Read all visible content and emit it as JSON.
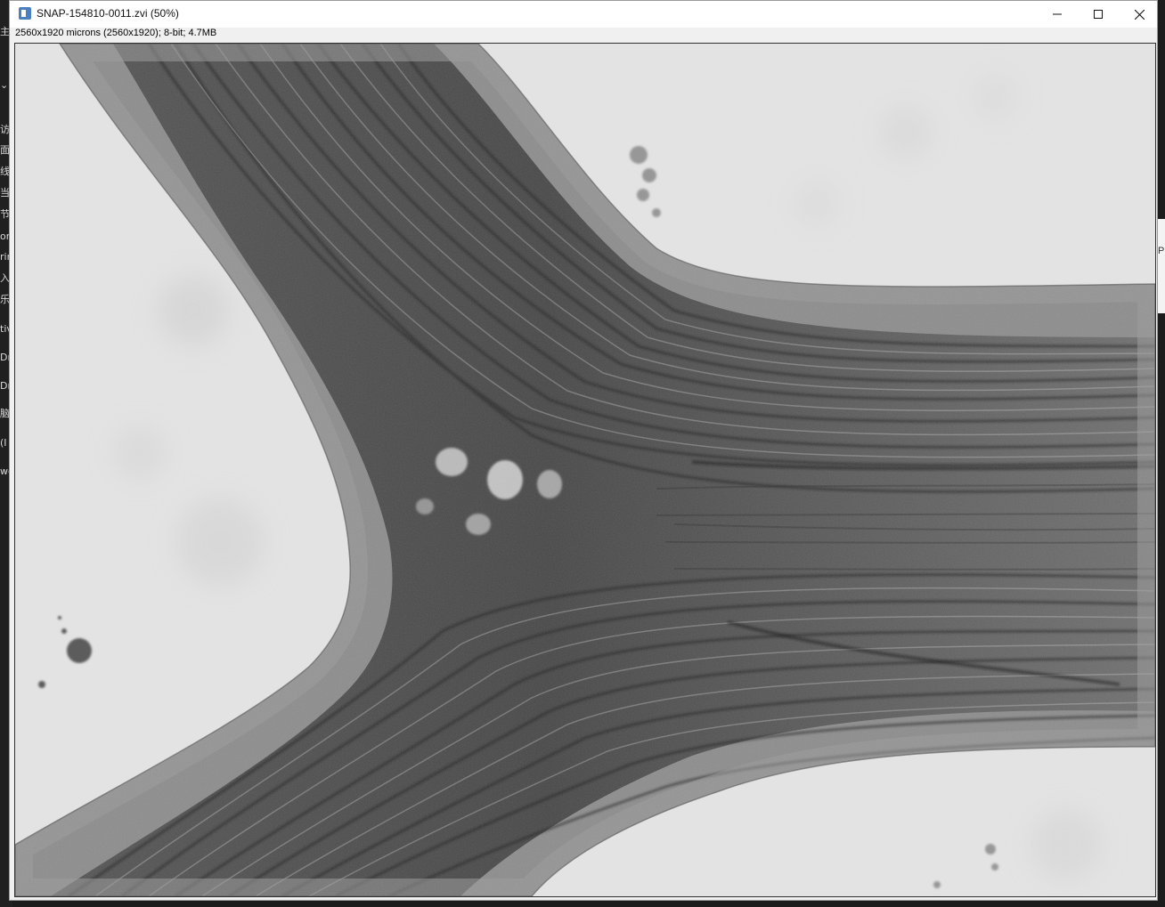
{
  "window": {
    "title": "SNAP-154810-0011.zvi (50%)",
    "info": "2560x1920 microns (2560x1920); 8-bit; 4.7MB",
    "icons": {
      "app": "imagej-icon",
      "minimize": "minimize-icon",
      "maximize": "maximize-icon",
      "close": "close-icon"
    }
  },
  "background_app": {
    "left_fragments": [
      "主",
      "访",
      "面",
      "线",
      "当",
      "节",
      "on",
      "rin",
      "入",
      "乐",
      "tiv",
      "Dr",
      "Dr",
      "脑",
      "(I",
      "wc"
    ],
    "right_fragment": "Pl"
  },
  "image": {
    "description_type": "grayscale micrograph",
    "colors": {
      "background": "#e4e4e4",
      "tissue_light": "#8a8a8a",
      "tissue_dark": "#2a2a2a"
    }
  }
}
